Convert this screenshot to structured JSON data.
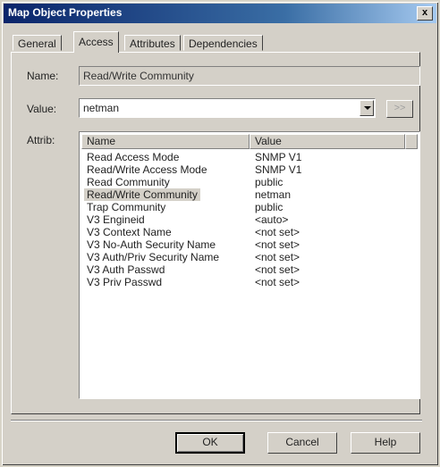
{
  "window": {
    "title": "Map Object Properties",
    "close_label": "x"
  },
  "tabs": [
    {
      "label": "General",
      "active": false
    },
    {
      "label": "Access",
      "active": true
    },
    {
      "label": "Attributes",
      "active": false
    },
    {
      "label": "Dependencies",
      "active": false
    }
  ],
  "form": {
    "name_label": "Name:",
    "name_value": "Read/Write Community",
    "value_label": "Value:",
    "value_value": "netman",
    "more_button_label": ">>",
    "attrib_label": "Attrib:"
  },
  "attrib_table": {
    "columns": [
      "Name",
      "Value"
    ],
    "rows": [
      {
        "name": "Read Access Mode",
        "value": "SNMP V1",
        "selected": false
      },
      {
        "name": "Read/Write Access Mode",
        "value": "SNMP V1",
        "selected": false
      },
      {
        "name": "Read Community",
        "value": "public",
        "selected": false
      },
      {
        "name": "Read/Write Community",
        "value": "netman",
        "selected": true
      },
      {
        "name": "Trap Community",
        "value": "public",
        "selected": false
      },
      {
        "name": "V3 Engineid",
        "value": "<auto>",
        "selected": false
      },
      {
        "name": "V3 Context Name",
        "value": "<not set>",
        "selected": false
      },
      {
        "name": "V3 No-Auth Security Name",
        "value": "<not set>",
        "selected": false
      },
      {
        "name": "V3 Auth/Priv Security Name",
        "value": "<not set>",
        "selected": false
      },
      {
        "name": "V3 Auth Passwd",
        "value": "<not set>",
        "selected": false
      },
      {
        "name": "V3 Priv Passwd",
        "value": "<not set>",
        "selected": false
      }
    ]
  },
  "buttons": {
    "ok": "OK",
    "cancel": "Cancel",
    "help": "Help"
  },
  "colors": {
    "face": "#d4d0c8",
    "title_start": "#0a246a",
    "title_end": "#a6caf0"
  }
}
